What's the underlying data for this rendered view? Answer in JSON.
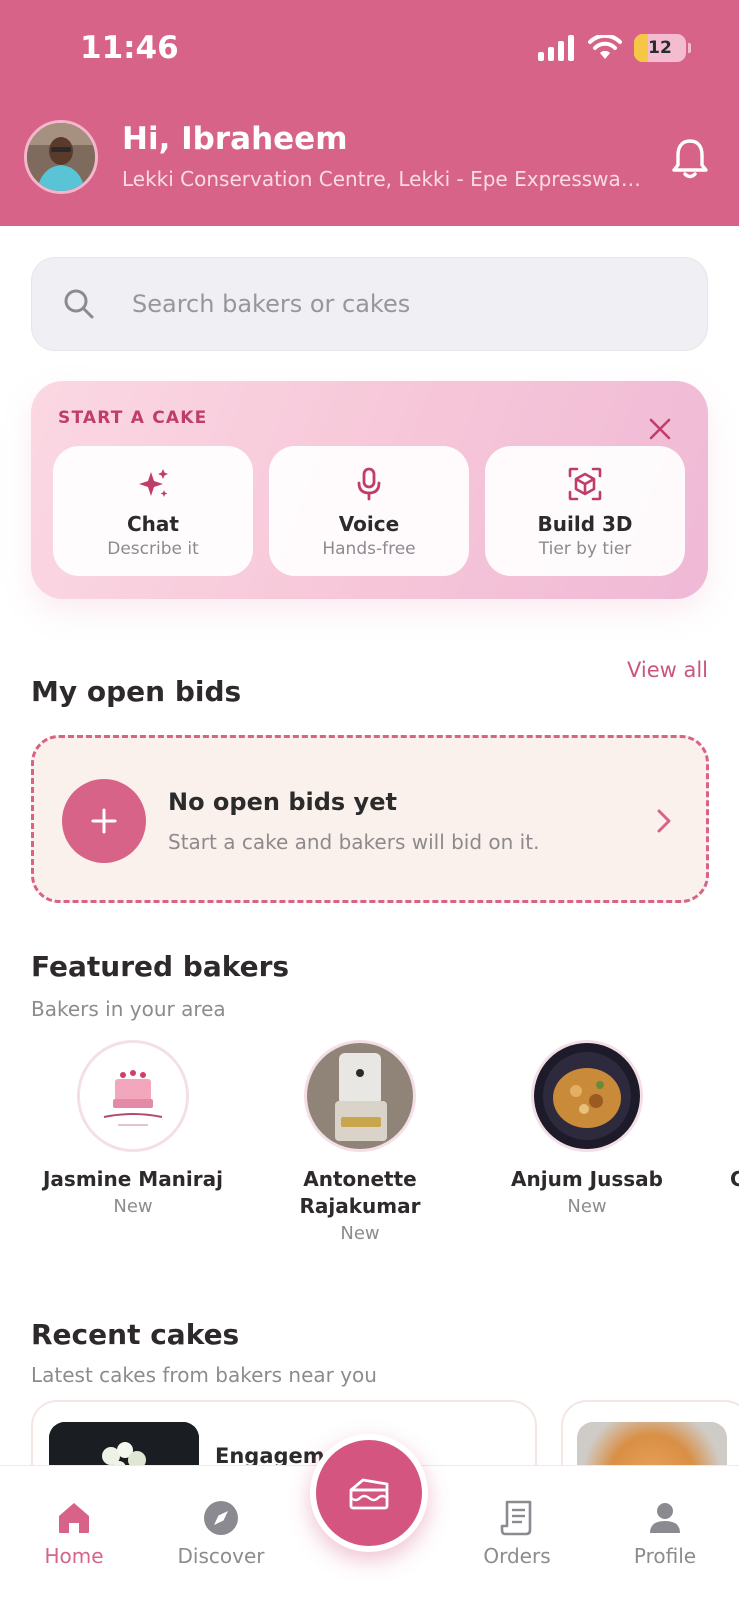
{
  "status_bar": {
    "time": "11:46",
    "battery": "12"
  },
  "header": {
    "greeting": "Hi, Ibraheem",
    "address": "Lekki Conservation Centre, Lekki - Epe Expressway…"
  },
  "search": {
    "placeholder": "Search bakers or cakes"
  },
  "start_cake": {
    "title": "START A CAKE",
    "options": [
      {
        "title": "Chat",
        "subtitle": "Describe it",
        "icon": "sparkles-icon"
      },
      {
        "title": "Voice",
        "subtitle": "Hands-free",
        "icon": "microphone-icon"
      },
      {
        "title": "Build 3D",
        "subtitle": "Tier by tier",
        "icon": "cube-3d-icon"
      }
    ]
  },
  "open_bids": {
    "title": "My open bids",
    "view_all": "View all",
    "empty_title": "No open bids yet",
    "empty_subtitle": "Start a cake and bakers will bid on it."
  },
  "featured_bakers": {
    "title": "Featured bakers",
    "subtitle": "Bakers in your area",
    "bakers": [
      {
        "name": "Jasmine Maniraj",
        "status": "New"
      },
      {
        "name": "Antonette Rajakumar",
        "status": "New"
      },
      {
        "name": "Anjum Jussab",
        "status": "New"
      },
      {
        "name": "C"
      }
    ]
  },
  "recent_cakes": {
    "title": "Recent cakes",
    "subtitle": "Latest cakes from bakers near you",
    "cards": [
      {
        "name": "Engagement"
      }
    ]
  },
  "bottom_nav": {
    "items": [
      {
        "label": "Home",
        "active": true
      },
      {
        "label": "Discover"
      },
      {
        "label": "Orders"
      },
      {
        "label": "Profile"
      }
    ]
  },
  "colors": {
    "brand": "#d76488",
    "accent_dark": "#c03d6b",
    "bids_bg": "#fbf1ec"
  }
}
